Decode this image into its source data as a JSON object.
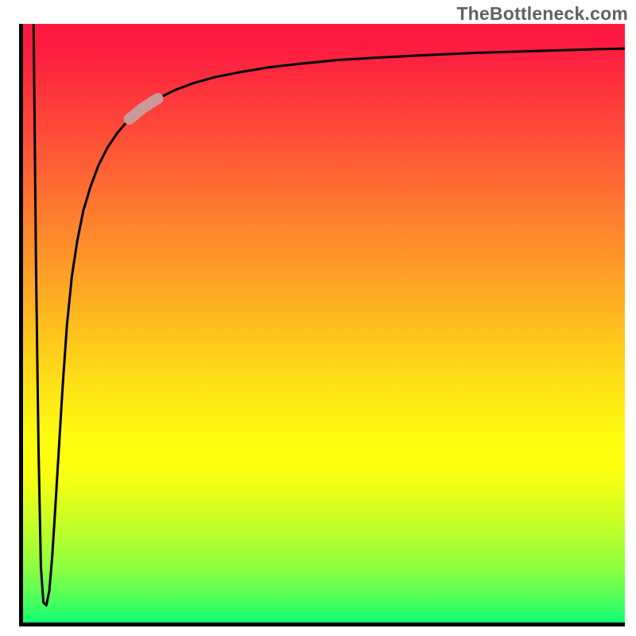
{
  "watermark": "TheBottleneck.com",
  "colors": {
    "curve": "#000000",
    "highlight": "#cc9999",
    "axis": "#000000"
  },
  "chart_data": {
    "type": "line",
    "title": "",
    "xlabel": "",
    "ylabel": "",
    "xlim": [
      0,
      100
    ],
    "ylim": [
      0,
      100
    ],
    "x": [
      2.4,
      2.8,
      3.2,
      3.6,
      4.0,
      4.5,
      5.0,
      5.5,
      6.0,
      6.6,
      7.2,
      7.9,
      8.7,
      9.6,
      10.6,
      11.8,
      13.1,
      14.6,
      16.3,
      18.2,
      20.4,
      22.9,
      25.7,
      28.9,
      32.5,
      36.6,
      41.3,
      46.6,
      52.6,
      59.4,
      67.0,
      75.7,
      85.5,
      96.0,
      100.0
    ],
    "values": [
      100.0,
      60.0,
      30.0,
      10.0,
      4.0,
      3.5,
      6.0,
      12.0,
      20.0,
      30.0,
      40.0,
      50.0,
      58.0,
      64.0,
      69.0,
      73.0,
      76.5,
      79.5,
      82.0,
      84.2,
      86.0,
      87.6,
      89.0,
      90.2,
      91.2,
      92.0,
      92.8,
      93.4,
      94.0,
      94.4,
      94.8,
      95.2,
      95.5,
      95.8,
      95.9
    ],
    "highlight_x_range": [
      18.2,
      22.9
    ],
    "background_gradient_stops": [
      {
        "pos": 0.0,
        "color": "#fe1940"
      },
      {
        "pos": 0.38,
        "color": "#fe9329"
      },
      {
        "pos": 0.69,
        "color": "#fefc0f"
      },
      {
        "pos": 1.0,
        "color": "#03ff79"
      }
    ]
  }
}
